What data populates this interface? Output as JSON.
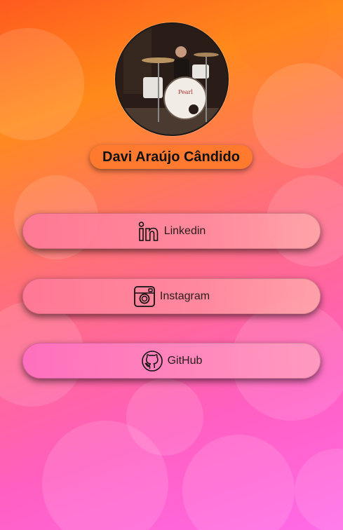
{
  "profile": {
    "name": "Davi Araújo Cândido",
    "avatar_alt": "drummer-photo"
  },
  "links": [
    {
      "label": "Linkedin",
      "icon": "linkedin-icon"
    },
    {
      "label": "Instagram",
      "icon": "instagram-icon"
    },
    {
      "label": "GitHub",
      "icon": "github-icon"
    }
  ],
  "colors": {
    "badge": "#ff7a2e",
    "background_top": "#ff5a1f",
    "background_bottom": "#ff6ae8"
  }
}
